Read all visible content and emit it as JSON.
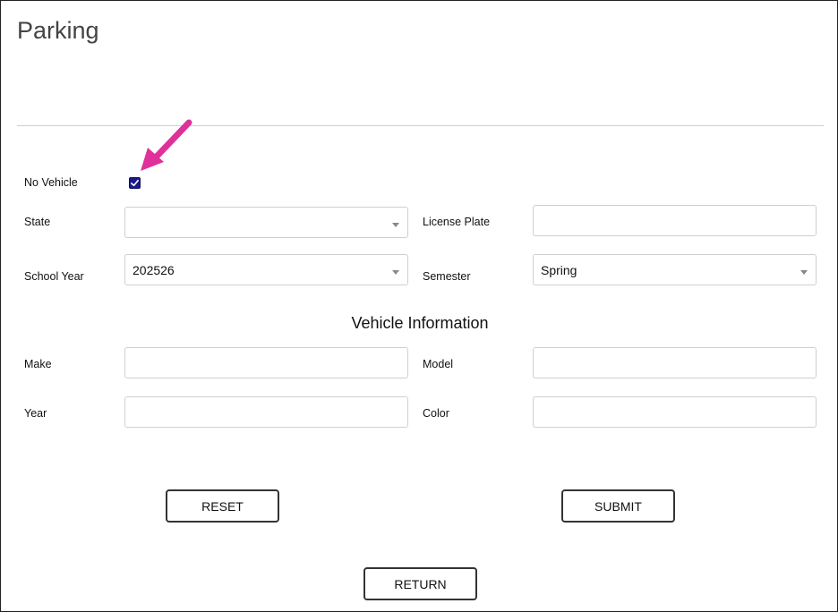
{
  "page": {
    "title": "Parking"
  },
  "form": {
    "no_vehicle": {
      "label": "No Vehicle",
      "checked": true
    },
    "state": {
      "label": "State",
      "value": ""
    },
    "license_plate": {
      "label": "License Plate",
      "value": ""
    },
    "school_year": {
      "label": "School Year",
      "value": "202526"
    },
    "semester": {
      "label": "Semester",
      "value": "Spring"
    }
  },
  "vehicle": {
    "section_title": "Vehicle Information",
    "make": {
      "label": "Make",
      "value": ""
    },
    "model": {
      "label": "Model",
      "value": ""
    },
    "year": {
      "label": "Year",
      "value": ""
    },
    "color": {
      "label": "Color",
      "value": ""
    }
  },
  "buttons": {
    "reset": "RESET",
    "submit": "SUBMIT",
    "return": "RETURN"
  },
  "colors": {
    "annotation_arrow": "#e0309a",
    "checkbox": "#1a1a8c"
  }
}
